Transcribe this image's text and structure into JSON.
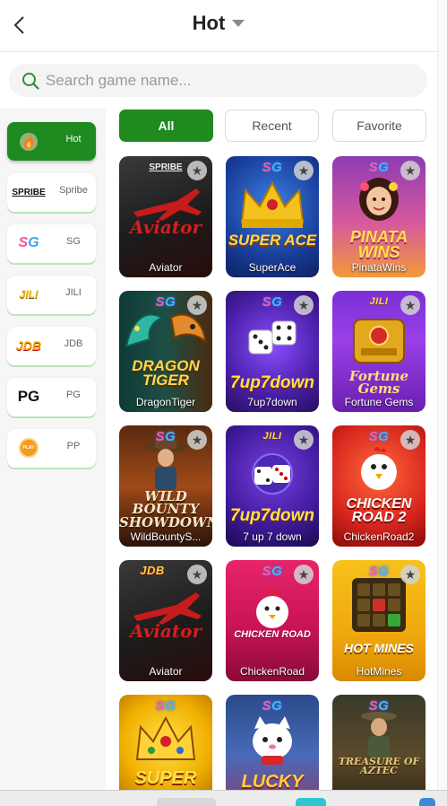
{
  "header": {
    "title": "Hot"
  },
  "search": {
    "placeholder": "Search game name..."
  },
  "sidebar": {
    "items": [
      {
        "label": "Hot",
        "logo": "flame-icon",
        "active": true
      },
      {
        "label": "Spribe",
        "logo_text": "SPRIBE"
      },
      {
        "label": "SG",
        "logo_text": "SG"
      },
      {
        "label": "JILI",
        "logo_text": "JILI"
      },
      {
        "label": "JDB",
        "logo_text": "JDB"
      },
      {
        "label": "PG",
        "logo_text": "PG"
      },
      {
        "label": "PP",
        "logo_text": "PLAY"
      }
    ]
  },
  "tabs": [
    {
      "label": "All",
      "active": true
    },
    {
      "label": "Recent"
    },
    {
      "label": "Favorite"
    }
  ],
  "games": [
    {
      "name": "Aviator",
      "provider": "SPRIBE",
      "art_text": "Aviator"
    },
    {
      "name": "SuperAce",
      "provider": "SG",
      "art_text": "SUPER ACE"
    },
    {
      "name": "PinataWins",
      "provider": "SG",
      "art_text": "PINATA WINS"
    },
    {
      "name": "DragonTiger",
      "provider": "SG",
      "art_text": "DRAGON TIGER"
    },
    {
      "name": "7up7down",
      "provider": "SG",
      "art_text": "7up7down"
    },
    {
      "name": "Fortune Gems",
      "provider": "JILI",
      "art_text": "Fortune Gems"
    },
    {
      "name": "WildBountyS...",
      "provider": "SG",
      "art_text": "WILD BOUNTY SHOWDOWN"
    },
    {
      "name": "7 up 7 down",
      "provider": "JILI",
      "art_text": "7up7down"
    },
    {
      "name": "ChickenRoad2",
      "provider": "SG",
      "art_text": "CHICKEN ROAD 2"
    },
    {
      "name": "Aviator",
      "provider": "JDB",
      "art_text": "Aviator"
    },
    {
      "name": "ChickenRoad",
      "provider": "SG",
      "art_text": "CHICKEN ROAD"
    },
    {
      "name": "HotMines",
      "provider": "SG",
      "art_text": "HOT MINES"
    },
    {
      "name": "",
      "provider": "SG",
      "art_text": "SUPER"
    },
    {
      "name": "",
      "provider": "SG",
      "art_text": "LUCKY"
    },
    {
      "name": "",
      "provider": "SG",
      "art_text": "TREASURE OF AZTEC"
    }
  ],
  "colors": {
    "accent": "#1f8a1f",
    "sidebar_bg": "#f6f6f6",
    "search_bg": "#f3f4f3",
    "search_icon": "#2f8f3a"
  },
  "icons": {
    "back": "chevron-left-icon",
    "dropdown": "caret-down-icon",
    "search": "search-icon",
    "favorite": "star-icon"
  }
}
